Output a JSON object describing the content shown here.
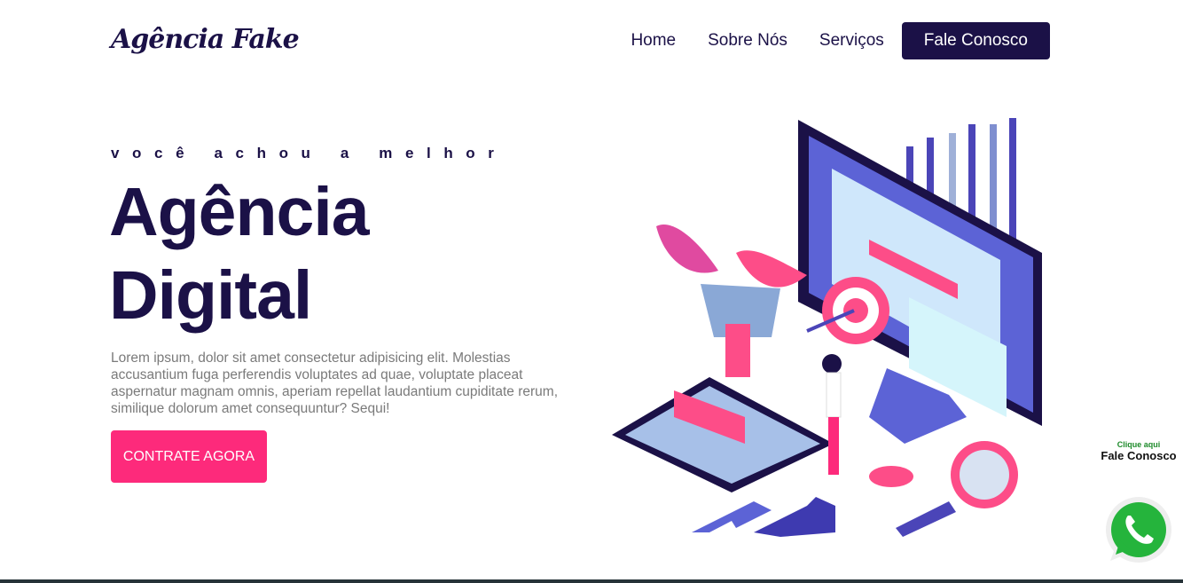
{
  "header": {
    "logo": "Agência Fake",
    "nav": [
      "Home",
      "Sobre Nós",
      "Serviços"
    ],
    "cta": "Fale Conosco"
  },
  "hero": {
    "kicker": "você achou a melhor",
    "title_line1": "Agência",
    "title_line2": "Digital",
    "text": "Lorem ipsum, dolor sit amet consectetur adipisicing elit. Molestias accusantium fuga perferendis voluptates ad quae, voluptate placeat aspernatur magnam omnis, aperiam repellat laudantium cupiditate rerum, similique dolorum amet consequuntur? Sequi!",
    "button": "CONTRATE AGORA"
  },
  "whatsapp": {
    "small": "Clique aqui",
    "big": "Fale Conosco",
    "icon": "whatsapp-icon"
  },
  "colors": {
    "navy": "#1b1147",
    "pink": "#fd2a7b",
    "whatsapp": "#25d366"
  }
}
